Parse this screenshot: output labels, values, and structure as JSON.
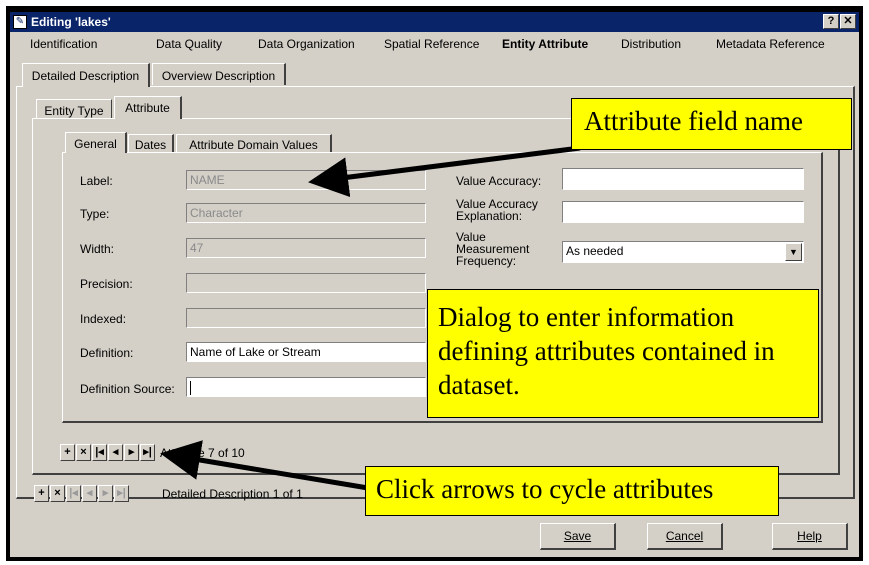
{
  "window": {
    "title": "Editing 'lakes'",
    "help_glyph": "?",
    "close_glyph": "✕",
    "title_icon": "edit-document-icon"
  },
  "section_tabs": [
    "Identification",
    "Data Quality",
    "Data Organization",
    "Spatial Reference",
    "Entity Attribute",
    "Distribution",
    "Metadata Reference"
  ],
  "active_section": "Entity Attribute",
  "desc_tabs": [
    "Detailed Description",
    "Overview Description"
  ],
  "entity_tabs": [
    "Entity Type",
    "Attribute"
  ],
  "attr_tabs": [
    "General",
    "Dates",
    "Attribute Domain Values"
  ],
  "fields": {
    "label": {
      "label": "Label:",
      "value": "NAME"
    },
    "type": {
      "label": "Type:",
      "value": "Character"
    },
    "width": {
      "label": "Width:",
      "value": "47"
    },
    "precision": {
      "label": "Precision:",
      "value": ""
    },
    "indexed": {
      "label": "Indexed:",
      "value": ""
    },
    "definition": {
      "label": "Definition:",
      "value": "Name of Lake or Stream"
    },
    "definition_source": {
      "label": "Definition Source:",
      "value": ""
    },
    "value_accuracy": {
      "label": "Value Accuracy:",
      "value": ""
    },
    "value_accuracy_expl": {
      "label_line1": "Value Accuracy",
      "label_line2": "Explanation:",
      "value": ""
    },
    "measurement_freq": {
      "label_line1": "Value",
      "label_line2": "Measurement",
      "label_line3": "Frequency:",
      "value": "As needed"
    }
  },
  "attribute_nav": {
    "status": "Attribute 7 of 10"
  },
  "description_nav": {
    "status": "Detailed Description 1 of 1"
  },
  "buttons": {
    "save": "Save",
    "cancel": "Cancel",
    "help": "Help"
  },
  "callouts": {
    "field_name": "Attribute field name",
    "dialog": "Dialog to enter information defining attributes contained in dataset.",
    "arrows": "Click arrows to cycle attributes"
  },
  "colors": {
    "callout_bg": "#ffff00",
    "title_bar": "#0a246a",
    "dialog_bg": "#d4d0c8"
  }
}
